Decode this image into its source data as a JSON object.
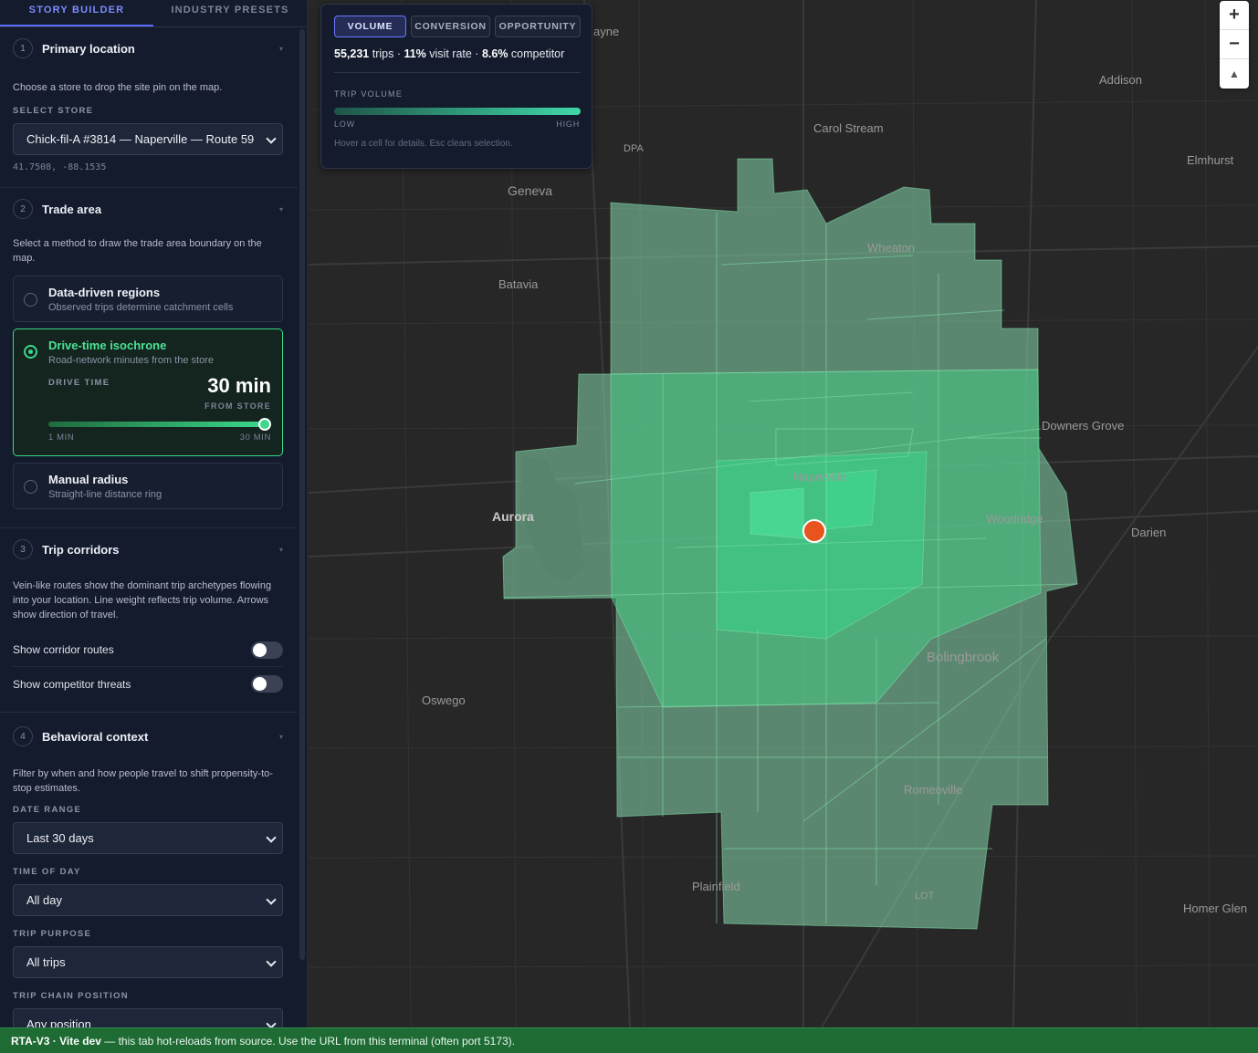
{
  "tabs": {
    "story_builder": "STORY BUILDER",
    "industry_presets": "INDUSTRY PRESETS"
  },
  "primary_location": {
    "num": "1",
    "title": "Primary location",
    "desc": "Choose a store to drop the site pin on the map.",
    "label": "SELECT STORE",
    "store": "Chick-fil-A #3814 — Naperville — Route 59",
    "coords": "41.7508, -88.1535"
  },
  "trade_area": {
    "num": "2",
    "title": "Trade area",
    "desc": "Select a method to draw the trade area boundary on the map.",
    "data_driven": {
      "title": "Data-driven regions",
      "sub": "Observed trips determine catchment cells"
    },
    "drive_time": {
      "title": "Drive-time isochrone",
      "sub": "Road-network minutes from the store",
      "label": "DRIVE TIME",
      "value": "30 min",
      "caption": "FROM STORE",
      "min_label": "1 MIN",
      "max_label": "30 MIN",
      "min": 1,
      "max": 30,
      "current": 30
    },
    "manual": {
      "title": "Manual radius",
      "sub": "Straight-line distance ring"
    }
  },
  "trip_corridors": {
    "num": "3",
    "title": "Trip corridors",
    "desc": "Vein-like routes show the dominant trip archetypes flowing into your location. Line weight reflects trip volume. Arrows show direction of travel.",
    "toggles": [
      {
        "label": "Show corridor routes",
        "on": false
      },
      {
        "label": "Show competitor threats",
        "on": false
      }
    ]
  },
  "behavioral_context": {
    "num": "4",
    "title": "Behavioral context",
    "desc": "Filter by when and how people travel to shift propensity-to-stop estimates.",
    "date_label": "DATE RANGE",
    "date_value": "Last 30 days",
    "time_label": "TIME OF DAY",
    "time_value": "All day",
    "purpose_label": "TRIP PURPOSE",
    "purpose_value": "All trips",
    "chain_label": "TRIP CHAIN POSITION",
    "chain_value": "Any position"
  },
  "legend": {
    "buttons": [
      "VOLUME",
      "CONVERSION",
      "OPPORTUNITY"
    ],
    "active_button": "VOLUME",
    "trips": "55,231",
    "trips_unit": "trips",
    "visit_rate": "11%",
    "visit_rate_unit": "visit rate",
    "competitor": "8.6%",
    "competitor_unit": "competitor",
    "scale_title": "TRIP VOLUME",
    "low": "LOW",
    "high": "HIGH",
    "hint": "Hover a cell for details. Esc clears selection."
  },
  "map": {
    "places": [
      "ayne",
      "Addison",
      "Carol Stream",
      "DPA",
      "Elmhurst",
      "Geneva",
      "Wheaton",
      "Batavia",
      "Downers Grove",
      "Naperville",
      "Aurora",
      "Woodridge",
      "Darien",
      "Bolingbrook",
      "Oswego",
      "Romeoville",
      "Plainfield",
      "LOT",
      "Homer Glen"
    ],
    "colors": {
      "fill_low": "#6fa78a",
      "fill_mid": "#3fc07f",
      "fill_high": "#35d487",
      "pin": "#e8541e"
    }
  },
  "zoom": {
    "in": "+",
    "out": "−",
    "compass": "▲"
  },
  "bottombar": {
    "brand": "RTA-V3 · Vite dev",
    "message": " — this tab hot-reloads from source. Use the URL from this terminal (often port 5173)."
  }
}
